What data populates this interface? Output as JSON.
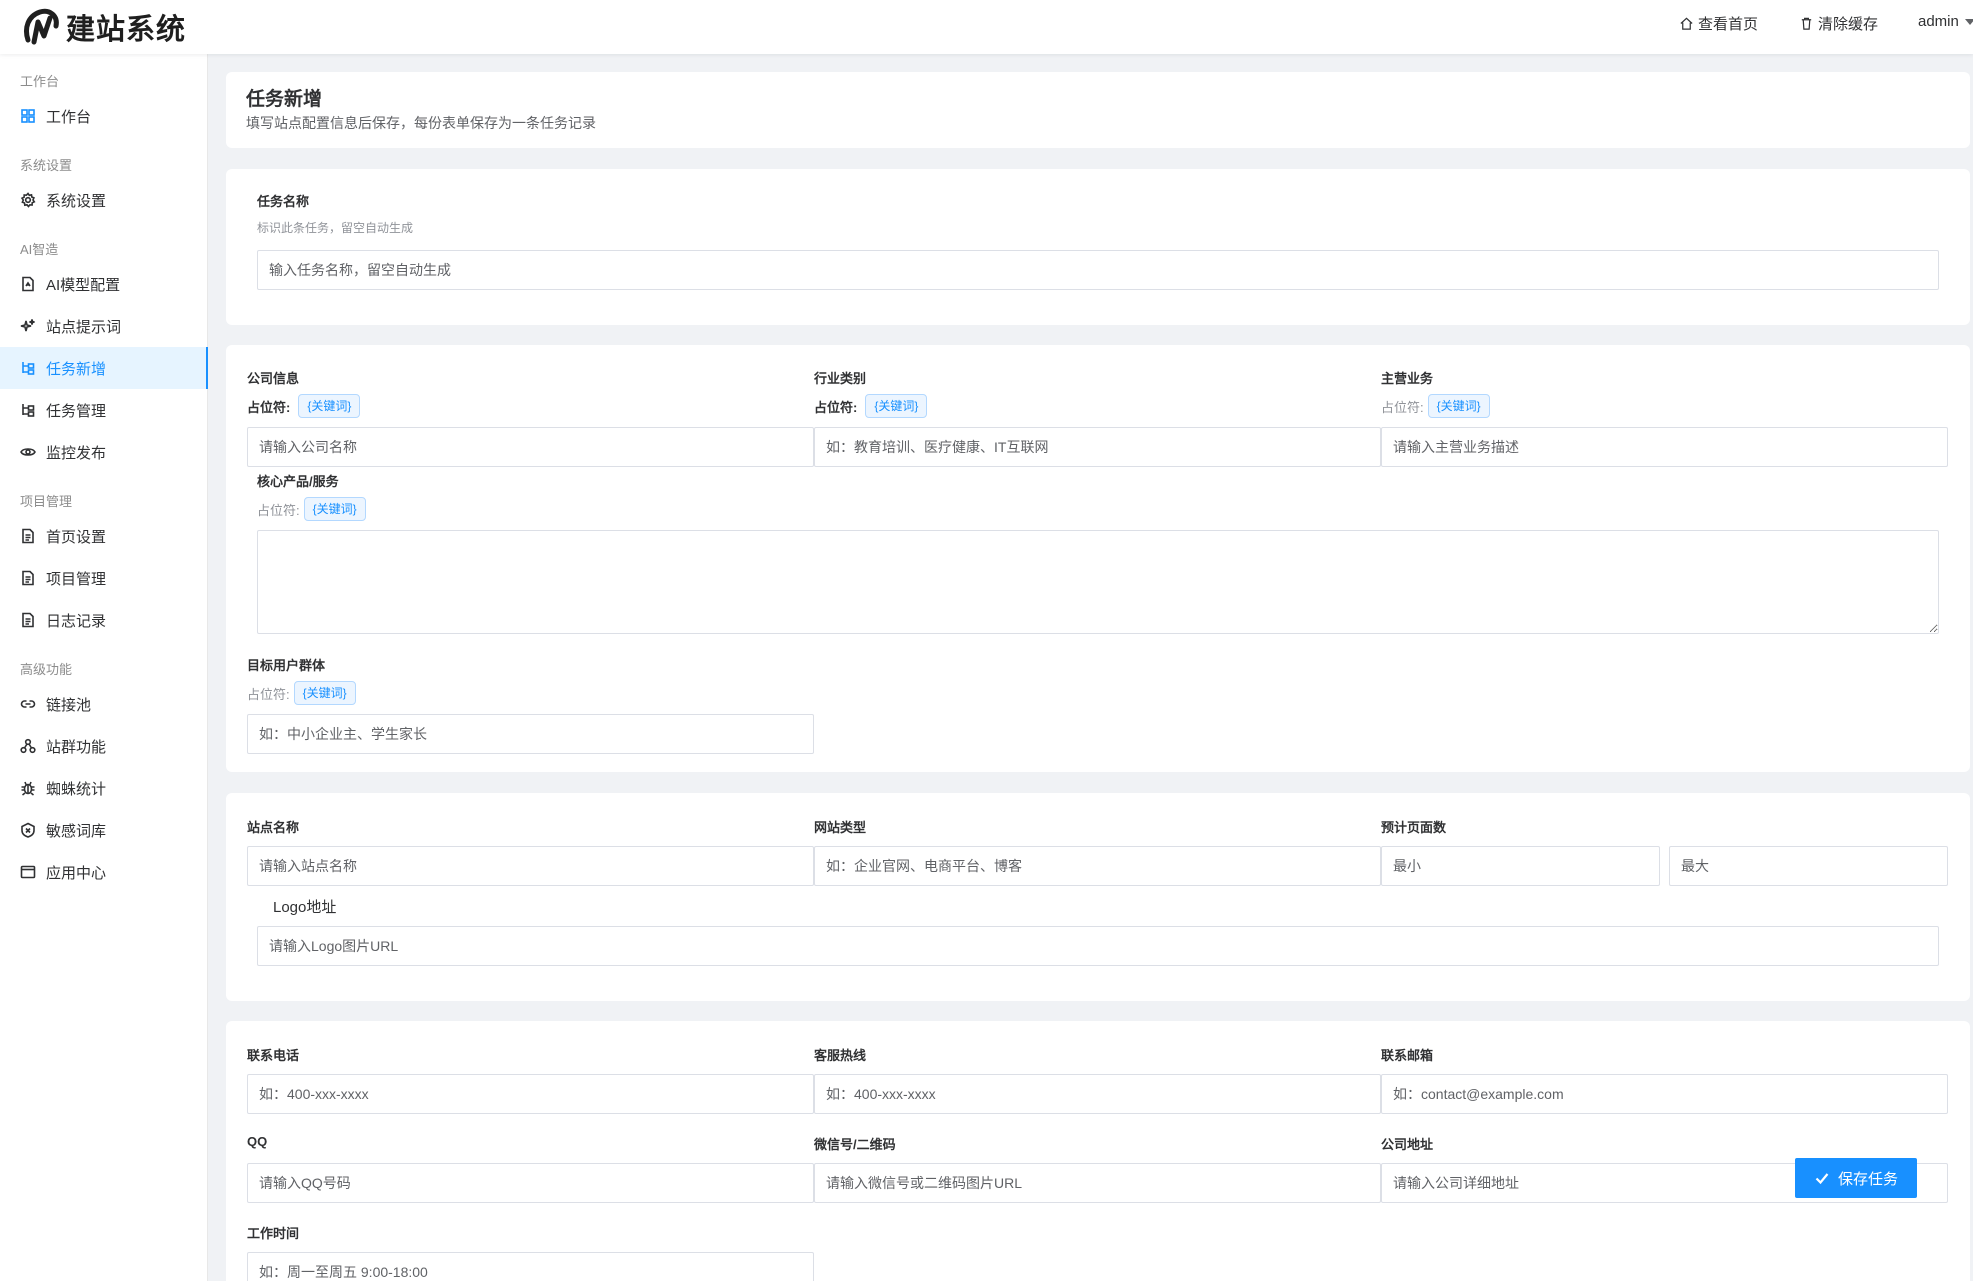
{
  "header": {
    "brand": "建站系统",
    "view_home": "查看首页",
    "clear_cache": "清除缓存",
    "user": "admin"
  },
  "sidebar": {
    "groups": [
      "工作台",
      "系统设置",
      "AI智造",
      "项目管理",
      "高级功能"
    ],
    "items": [
      {
        "label": "工作台",
        "icon": "grid-icon"
      },
      {
        "label": "系统设置",
        "icon": "gear-icon"
      },
      {
        "label": "AI模型配置",
        "icon": "file-ai-icon"
      },
      {
        "label": "站点提示词",
        "icon": "sparkle-icon"
      },
      {
        "label": "任务新增",
        "icon": "tree-icon",
        "active": true
      },
      {
        "label": "任务管理",
        "icon": "tree-icon"
      },
      {
        "label": "监控发布",
        "icon": "eye-icon"
      },
      {
        "label": "首页设置",
        "icon": "document-icon"
      },
      {
        "label": "项目管理",
        "icon": "document-icon"
      },
      {
        "label": "日志记录",
        "icon": "document-icon"
      },
      {
        "label": "链接池",
        "icon": "link-icon"
      },
      {
        "label": "站群功能",
        "icon": "cluster-icon"
      },
      {
        "label": "蜘蛛统计",
        "icon": "bug-icon"
      },
      {
        "label": "敏感词库",
        "icon": "shield-icon"
      },
      {
        "label": "应用中心",
        "icon": "window-icon"
      }
    ]
  },
  "page": {
    "title": "任务新增",
    "subtitle": "填写站点配置信息后保存，每份表单保存为一条任务记录"
  },
  "task_name": {
    "label": "任务名称",
    "hint": "标识此条任务，留空自动生成",
    "placeholder": "输入任务名称，留空自动生成"
  },
  "company": {
    "placeholder_label": "占位符:",
    "tag": "{关键词}",
    "company_info_label": "公司信息",
    "company_info_placeholder": "请输入公司名称",
    "industry_label": "行业类别",
    "industry_placeholder": "如：教育培训、医疗健康、IT互联网",
    "business_label": "主营业务",
    "business_placeholder": "请输入主营业务描述",
    "core_label": "核心产品/服务",
    "audience_label": "目标用户群体",
    "audience_placeholder": "如：中小企业主、学生家长"
  },
  "site": {
    "name_label": "站点名称",
    "name_placeholder": "请输入站点名称",
    "type_label": "网站类型",
    "type_placeholder": "如：企业官网、电商平台、博客",
    "pages_label": "预计页面数",
    "pages_min": "最小",
    "pages_max": "最大",
    "logo_label": "Logo地址",
    "logo_placeholder": "请输入Logo图片URL"
  },
  "contact": {
    "phone_label": "联系电话",
    "phone_placeholder": "如：400-xxx-xxxx",
    "hotline_label": "客服热线",
    "hotline_placeholder": "如：400-xxx-xxxx",
    "email_label": "联系邮箱",
    "email_placeholder": "如：contact@example.com",
    "qq_label": "QQ",
    "qq_placeholder": "请输入QQ号码",
    "wechat_label": "微信号/二维码",
    "wechat_placeholder": "请输入微信号或二维码图片URL",
    "address_label": "公司地址",
    "address_placeholder": "请输入公司详细地址",
    "hours_label": "工作时间",
    "hours_placeholder": "如：周一至周五 9:00-18:00"
  },
  "actions": {
    "save": "保存任务"
  }
}
